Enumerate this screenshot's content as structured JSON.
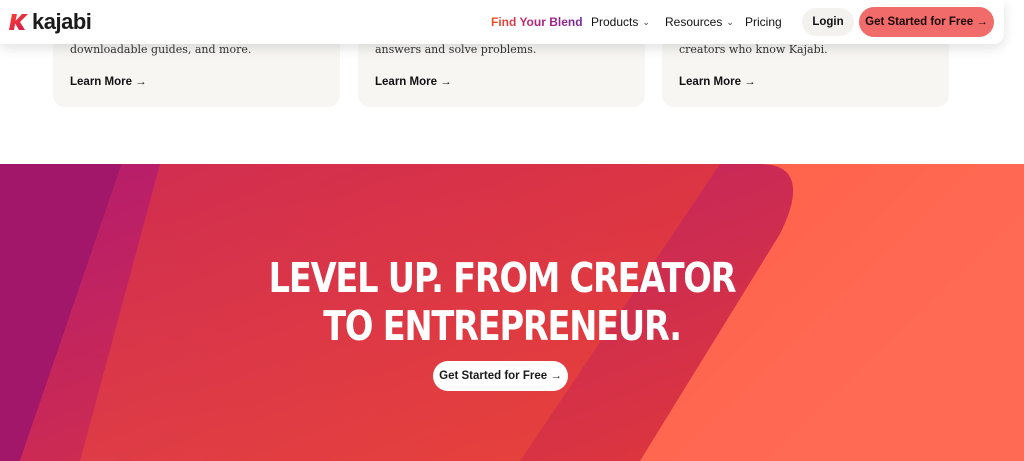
{
  "header": {
    "logo_text": "kajabi",
    "nav": {
      "blend": "Find Your Blend",
      "products": "Products",
      "resources": "Resources",
      "pricing": "Pricing"
    },
    "login": "Login",
    "cta": "Get Started for Free →"
  },
  "cards": [
    {
      "text": "downloadable guides, and more.",
      "link": "Learn More →"
    },
    {
      "text": "answers and solve problems.",
      "link": "Learn More →"
    },
    {
      "text": "creators who know Kajabi.",
      "link": "Learn More →"
    }
  ],
  "hero": {
    "title_line1": "LEVEL UP. FROM CREATOR",
    "title_line2": "TO ENTREPRENEUR.",
    "cta": "Get Started for Free →"
  },
  "colors": {
    "brand_coral": "#f26b6b",
    "hero_orange": "#ff4f2a",
    "hero_magenta": "#a3176b",
    "card_bg": "#f7f6f3"
  },
  "icons": {
    "logo": "kajabi-k-logo-icon",
    "dropdown": "chevron-down-icon"
  }
}
